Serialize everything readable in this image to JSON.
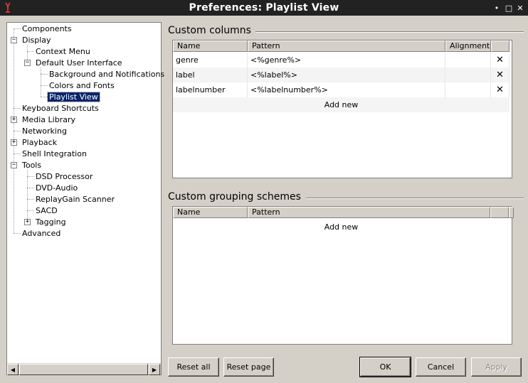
{
  "window": {
    "title": "Preferences: Playlist View"
  },
  "tree": {
    "items": [
      {
        "label": "Components"
      },
      {
        "label": "Display"
      },
      {
        "label": "Context Menu"
      },
      {
        "label": "Default User Interface"
      },
      {
        "label": "Background and Notifications"
      },
      {
        "label": "Colors and Fonts"
      },
      {
        "label": "Playlist View"
      },
      {
        "label": "Keyboard Shortcuts"
      },
      {
        "label": "Media Library"
      },
      {
        "label": "Networking"
      },
      {
        "label": "Playback"
      },
      {
        "label": "Shell Integration"
      },
      {
        "label": "Tools"
      },
      {
        "label": "DSD Processor"
      },
      {
        "label": "DVD-Audio"
      },
      {
        "label": "ReplayGain Scanner"
      },
      {
        "label": "SACD"
      },
      {
        "label": "Tagging"
      },
      {
        "label": "Advanced"
      }
    ],
    "selected": "Playlist View"
  },
  "custom_columns": {
    "title": "Custom columns",
    "headers": [
      "Name",
      "Pattern",
      "Alignment",
      ""
    ],
    "rows": [
      {
        "name": "genre",
        "pattern": "<%genre%>",
        "alignment": "",
        "delete": "✕"
      },
      {
        "name": "label",
        "pattern": "<%label%>",
        "alignment": "",
        "delete": "✕"
      },
      {
        "name": "labelnumber",
        "pattern": "<%labelnumber%>",
        "alignment": "",
        "delete": "✕"
      }
    ],
    "add_new": "Add new"
  },
  "grouping": {
    "title": "Custom grouping schemes",
    "headers": [
      "Name",
      "Pattern",
      "",
      ""
    ],
    "add_new": "Add new"
  },
  "buttons": {
    "reset_all": "Reset all",
    "reset_page": "Reset page",
    "ok": "OK",
    "cancel": "Cancel",
    "apply": "Apply"
  },
  "titlebar_glyphs": {
    "close": "✕",
    "maximize": "□",
    "minimize": "•"
  },
  "colors": {
    "selection": "#0a246a",
    "titlebar": "#222222",
    "dialog": "#d4d0c8"
  }
}
